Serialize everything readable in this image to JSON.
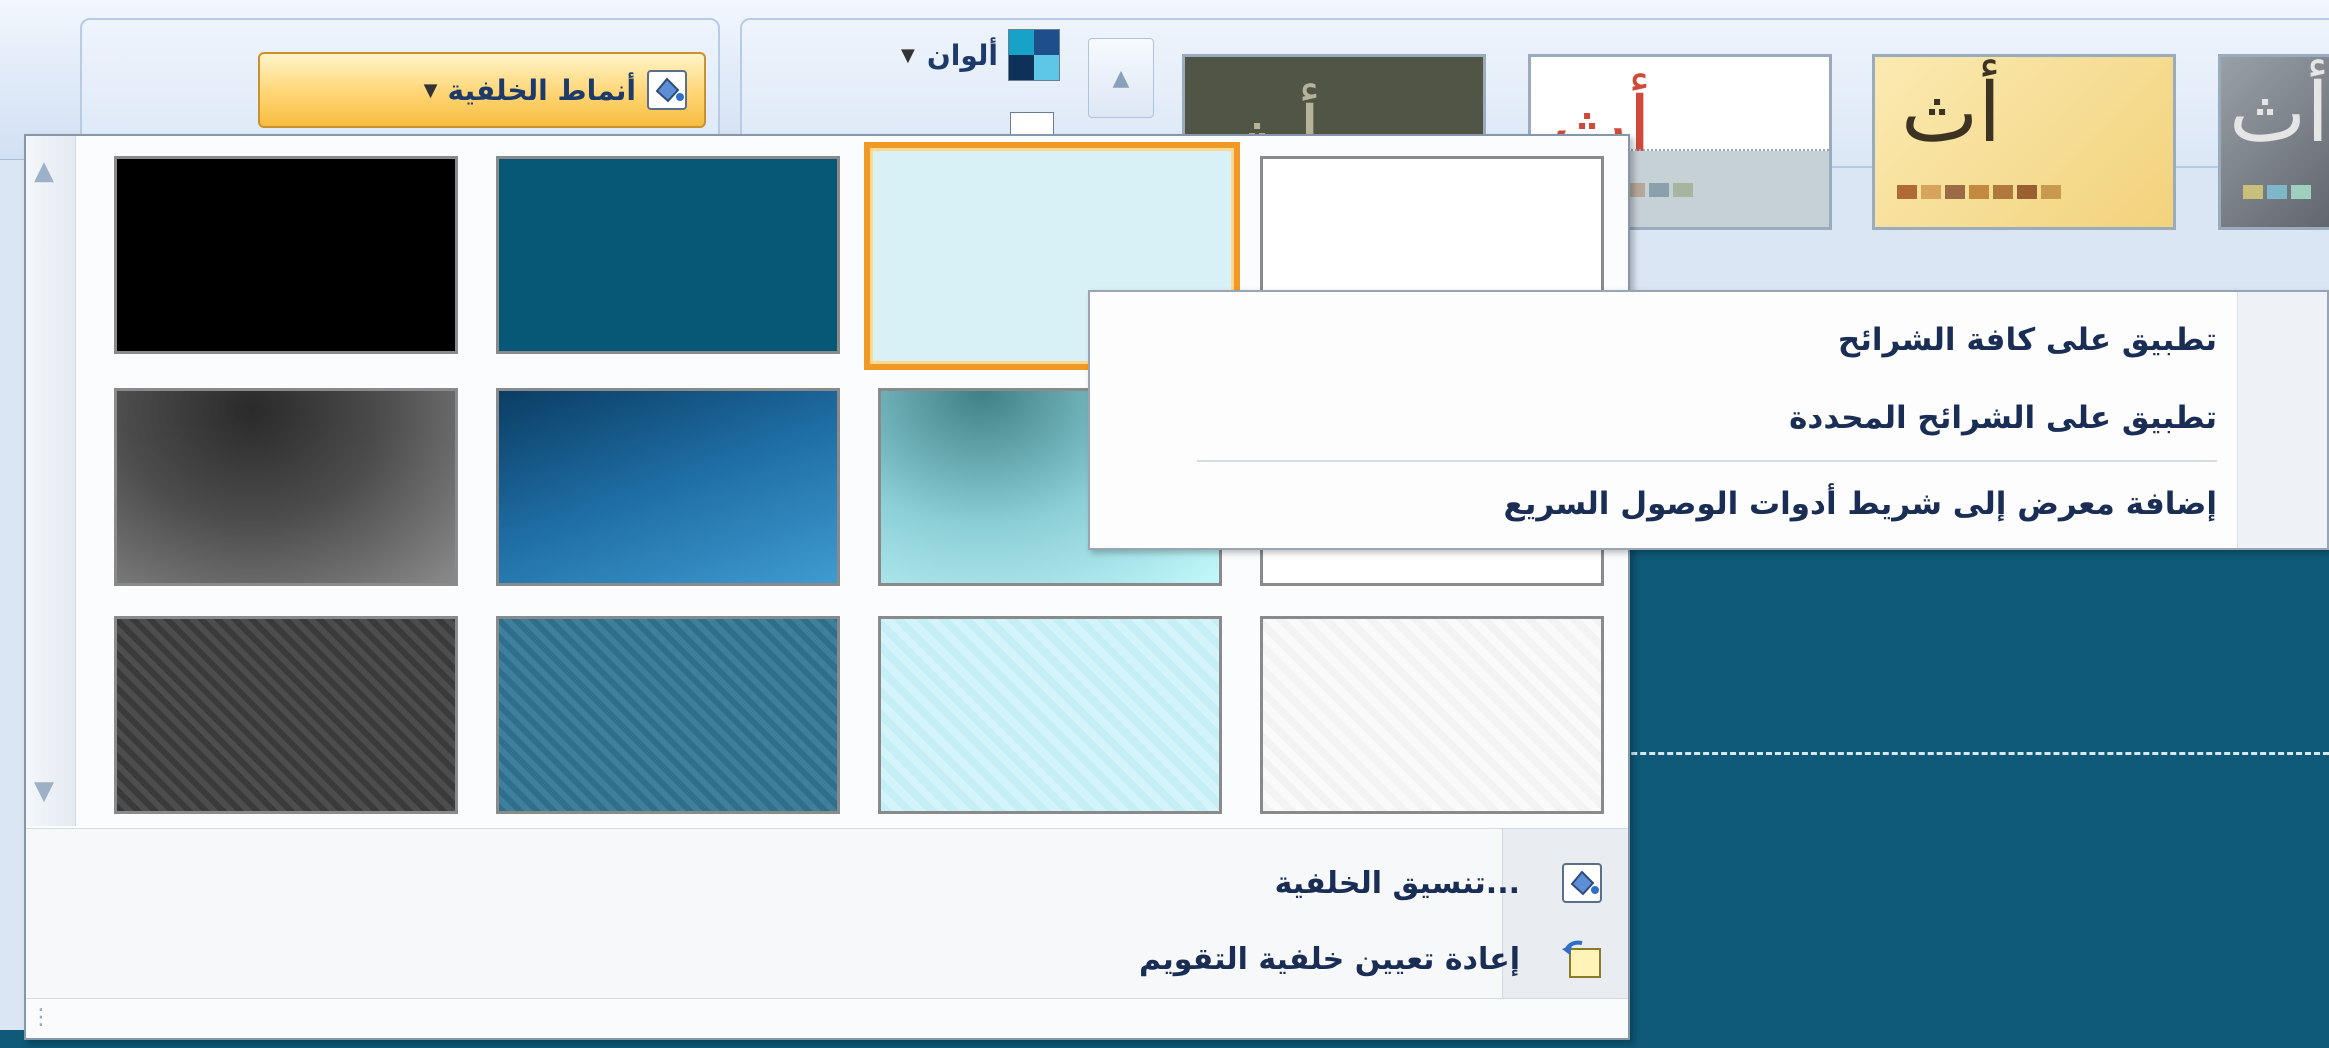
{
  "ribbon": {
    "background_styles_label": "أنماط الخلفية",
    "colors_label": "ألوان",
    "themes": [
      {
        "letters": "أث",
        "bg": "#505545",
        "fg": "#b7b29a"
      },
      {
        "letters": "أث",
        "bg": "#ffffff",
        "fg": "#d04a3c"
      },
      {
        "letters": "أث",
        "bg": "#f6dc92",
        "fg": "#3d3323"
      },
      {
        "letters": "أث",
        "bg": "#7b7f86",
        "fg": "#e5e5e5"
      }
    ]
  },
  "gallery": {
    "tiles": [
      {
        "row": 1,
        "col": 1,
        "name": "white",
        "selected": false
      },
      {
        "row": 1,
        "col": 2,
        "name": "light-cyan",
        "selected": true
      },
      {
        "row": 1,
        "col": 3,
        "name": "teal",
        "selected": false
      },
      {
        "row": 1,
        "col": 4,
        "name": "black",
        "selected": false
      },
      {
        "row": 2,
        "col": 1,
        "name": "white-gradient",
        "selected": false
      },
      {
        "row": 2,
        "col": 2,
        "name": "cyan-gradient",
        "selected": false
      },
      {
        "row": 2,
        "col": 3,
        "name": "blue-gradient",
        "selected": false
      },
      {
        "row": 2,
        "col": 4,
        "name": "gray-gradient",
        "selected": false
      },
      {
        "row": 3,
        "col": 1,
        "name": "white-texture",
        "selected": false
      },
      {
        "row": 3,
        "col": 2,
        "name": "cyan-texture",
        "selected": false
      },
      {
        "row": 3,
        "col": 3,
        "name": "teal-texture",
        "selected": false
      },
      {
        "row": 3,
        "col": 4,
        "name": "dark-texture",
        "selected": false
      }
    ],
    "footer": {
      "format_background": "تنسيق الخلفية...",
      "reset_background": "إعادة تعيين خلفية التقويم"
    }
  },
  "context_menu": {
    "apply_all": "تطبيق على كافة الشرائح",
    "apply_selected": "تطبيق على الشرائح المحددة",
    "add_to_quick_access": "إضافة معرض إلى شريط أدوات الوصول السريع"
  },
  "colors": {
    "accent_orange": "#f09a25",
    "slide_teal": "#0e5a78",
    "menu_text": "#1a2e55"
  }
}
